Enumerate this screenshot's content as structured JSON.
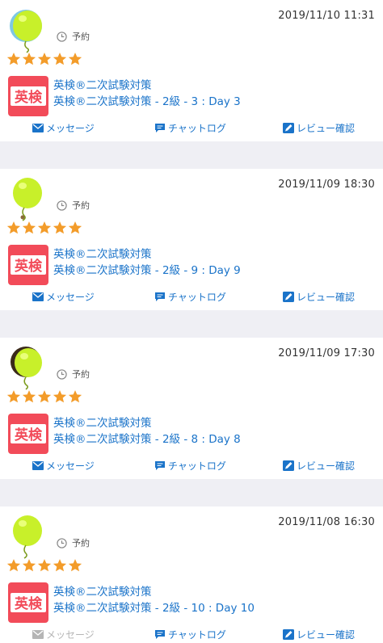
{
  "reviews": [
    {
      "date": "2019/11/10 11:31",
      "type": "予約",
      "rating": 5,
      "course_line1": "英検®二次試験対策",
      "course_line2": "英検®二次試験対策 - 2級 - 3 : Day 3",
      "message_label": "メッセージ",
      "message_enabled": true,
      "chatlog_label": "チャットログ",
      "review_label": "レビュー確認"
    },
    {
      "date": "2019/11/09 18:30",
      "type": "予約",
      "rating": 5,
      "course_line1": "英検®二次試験対策",
      "course_line2": "英検®二次試験対策 - 2級 - 9 : Day 9",
      "message_label": "メッセージ",
      "message_enabled": true,
      "chatlog_label": "チャットログ",
      "review_label": "レビュー確認"
    },
    {
      "date": "2019/11/09 17:30",
      "type": "予約",
      "rating": 5,
      "course_line1": "英検®二次試験対策",
      "course_line2": "英検®二次試験対策 - 2級 - 8 : Day 8",
      "message_label": "メッセージ",
      "message_enabled": true,
      "chatlog_label": "チャットログ",
      "review_label": "レビュー確認"
    },
    {
      "date": "2019/11/08 16:30",
      "type": "予約",
      "rating": 5,
      "course_line1": "英検®二次試験対策",
      "course_line2": "英検®二次試験対策 - 2級 - 10 : Day 10",
      "message_label": "メッセージ",
      "message_enabled": false,
      "chatlog_label": "チャットログ",
      "review_label": "レビュー確認"
    }
  ],
  "logo_text": "英検",
  "colors": {
    "link": "#1a73c9",
    "star": "#f39c2a",
    "logo_bg": "#f24b59",
    "separator": "#efeff4",
    "disabled": "#b5b5b5",
    "avatar": "#c8f02a"
  }
}
